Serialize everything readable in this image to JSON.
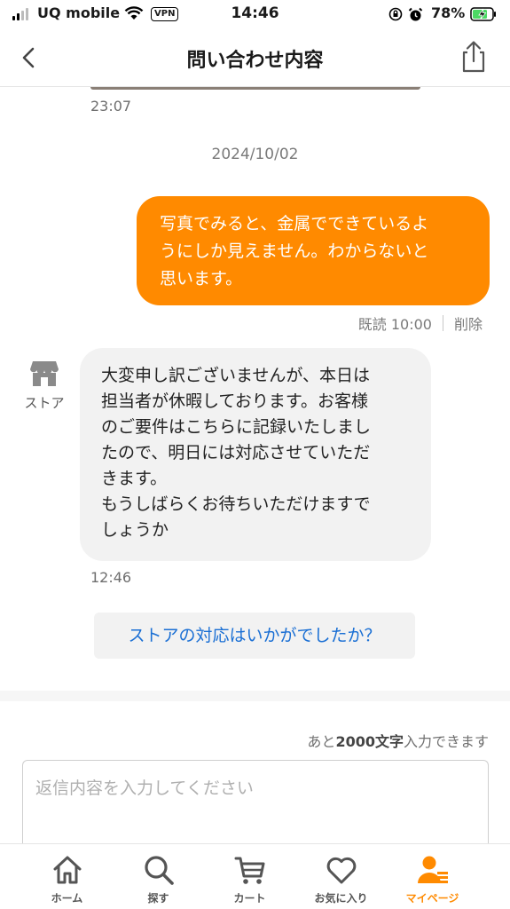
{
  "status_bar": {
    "carrier": "UQ mobile",
    "vpn": "VPN",
    "time": "14:46",
    "battery": "78%"
  },
  "nav": {
    "title": "問い合わせ内容",
    "back_icon": "chevron-left-icon",
    "share_icon": "share-icon"
  },
  "chat": {
    "previous_time": "23:07",
    "date_separator": "2024/10/02",
    "user_message": {
      "text": "写真でみると、金属でできているよ\nうにしか見えません。わからないと\n思います。",
      "read_label": "既読 10:00",
      "delete_label": "削除"
    },
    "store_message": {
      "sender_label": "ストア",
      "text": "大変申し訳ございませんが、本日は\n担当者が休暇しております。お客様\nのご要件はこちらに記録いたしまし\nたので、明日には対応させていただ\nきます。\nもうしばらくお待ちいただけますで\nしょうか",
      "time": "12:46"
    },
    "survey_button": "ストアの対応はいかがでしたか？"
  },
  "input": {
    "count_prefix": "あと",
    "count_value": "2000文字",
    "count_suffix": "入力できます",
    "placeholder": "返信内容を入力してください",
    "value": ""
  },
  "tabs": [
    {
      "label": "ホーム",
      "icon": "home-icon",
      "active": false
    },
    {
      "label": "探す",
      "icon": "search-icon",
      "active": false
    },
    {
      "label": "カート",
      "icon": "cart-icon",
      "active": false
    },
    {
      "label": "お気に入り",
      "icon": "heart-icon",
      "active": false
    },
    {
      "label": "マイページ",
      "icon": "user-icon",
      "active": true
    }
  ],
  "colors": {
    "accent": "#ff8a00",
    "link": "#1a6fd4",
    "bubble_gray": "#f2f2f2"
  }
}
